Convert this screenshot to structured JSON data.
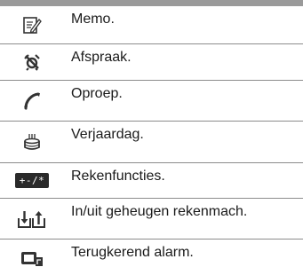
{
  "rows": [
    {
      "icon": "memo-icon",
      "label": "Memo."
    },
    {
      "icon": "appointment-icon",
      "label": "Afspraak."
    },
    {
      "icon": "phone-call-icon",
      "label": "Oproep."
    },
    {
      "icon": "birthday-cake-icon",
      "label": "Verjaardag."
    },
    {
      "icon": "calculator-functions-icon",
      "icon_text": "+-/*",
      "label": "Rekenfuncties."
    },
    {
      "icon": "memory-in-out-icon",
      "label": "In/uit geheugen rekenmach."
    },
    {
      "icon": "recurring-alarm-icon",
      "label": "Terugkerend alarm."
    }
  ]
}
